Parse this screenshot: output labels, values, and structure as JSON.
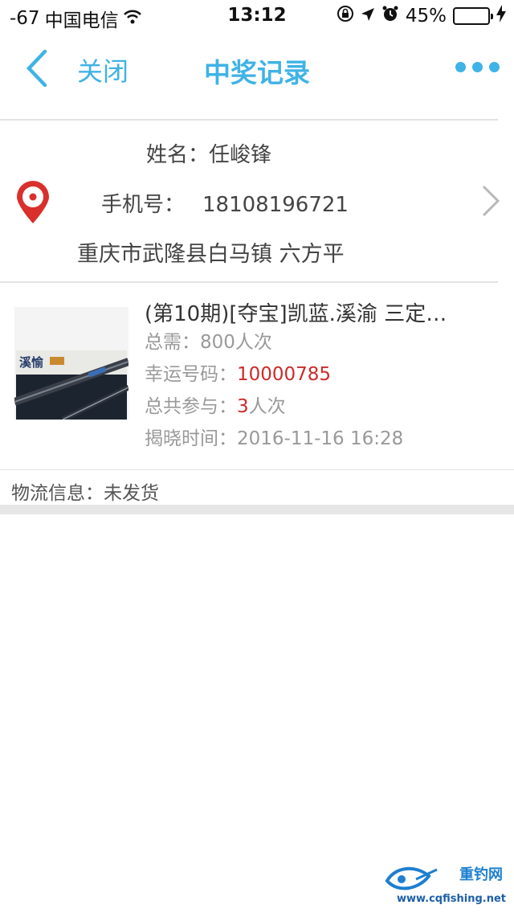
{
  "status_bar": {
    "signal": "-67",
    "carrier": "中国电信",
    "time": "13:12",
    "battery": "45%",
    "battery_level": 0.45
  },
  "nav": {
    "close_label": "关闭",
    "title": "中奖记录"
  },
  "address": {
    "name_label": "姓名：",
    "name": "任峻锋",
    "phone_label": "手机号：",
    "phone": "18108196721",
    "address": "重庆市武隆县白马镇 六方平"
  },
  "prize": {
    "title": "(第10期)[夺宝]凯蓝.溪渝 三定…",
    "total_label": "总需：",
    "total_value": "800人次",
    "lucky_label": "幸运号码：",
    "lucky_number": "10000785",
    "joined_label": "总共参与：",
    "joined_count": "3",
    "joined_unit": "人次",
    "reveal_label": "揭晓时间：",
    "reveal_time": "2016-11-16 16:28",
    "thumbnail_text": "溪愉"
  },
  "logistics": {
    "label": "物流信息：",
    "status": "未发货"
  },
  "watermark": {
    "brand": "重钓网",
    "url": "www.cqfishing.net"
  },
  "colors": {
    "accent": "#3fb3e6",
    "highlight_red": "#cc2b2b",
    "pin_red": "#d9302c"
  }
}
